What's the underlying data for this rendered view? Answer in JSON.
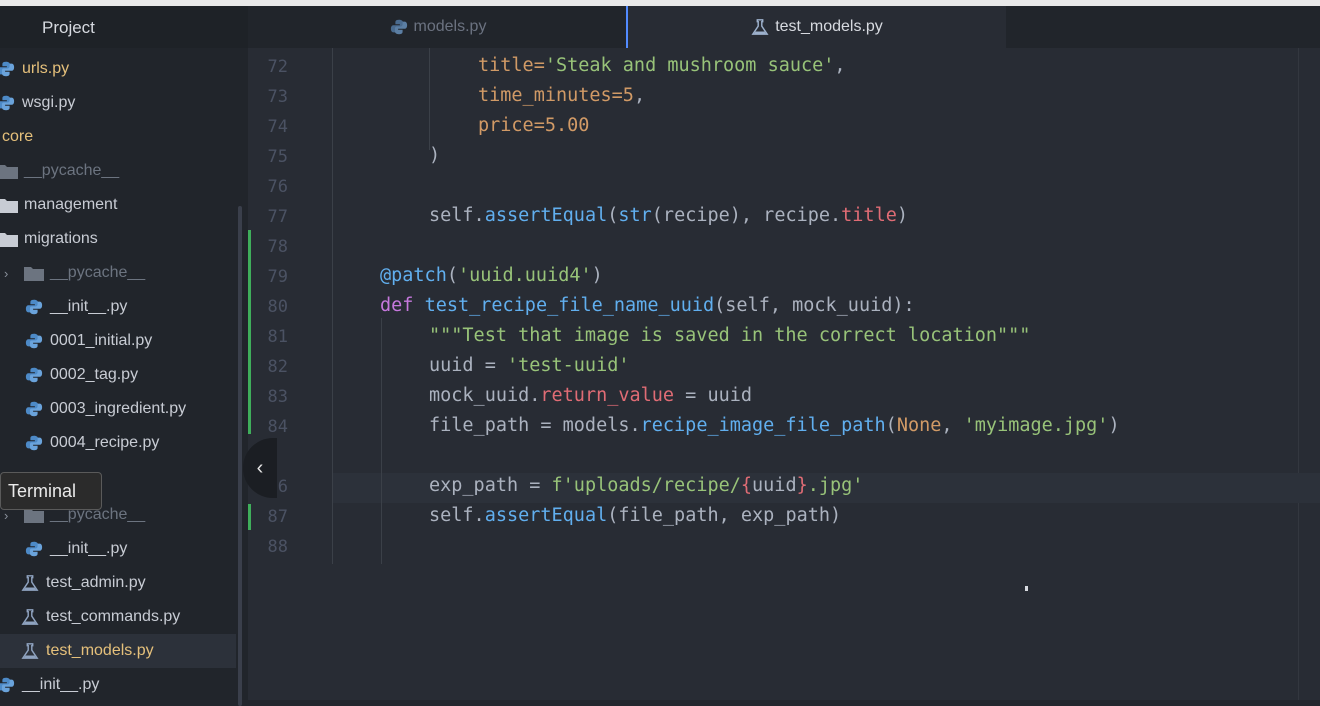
{
  "sidebar": {
    "title": "Project",
    "items": [
      {
        "label": "urls.py",
        "icon": "python-icon"
      },
      {
        "label": "wsgi.py",
        "icon": "python-icon"
      },
      {
        "label": "core",
        "icon": ""
      },
      {
        "label": "__pycache__",
        "icon": "folder-icon"
      },
      {
        "label": "management",
        "icon": "folder-icon"
      },
      {
        "label": "migrations",
        "icon": "folder-icon"
      },
      {
        "label": "__pycache__",
        "icon": "folder-icon"
      },
      {
        "label": "__init__.py",
        "icon": "python-icon"
      },
      {
        "label": "0001_initial.py",
        "icon": "python-icon"
      },
      {
        "label": "0002_tag.py",
        "icon": "python-icon"
      },
      {
        "label": "0003_ingredient.py",
        "icon": "python-icon"
      },
      {
        "label": "0004_recipe.py",
        "icon": "python-icon"
      },
      {
        "label": "__pycache__",
        "icon": "folder-icon"
      },
      {
        "label": "__init__.py",
        "icon": "python-icon"
      },
      {
        "label": "test_admin.py",
        "icon": "test-flask-icon"
      },
      {
        "label": "test_commands.py",
        "icon": "test-flask-icon"
      },
      {
        "label": "test_models.py",
        "icon": "test-flask-icon"
      },
      {
        "label": "__init__.py",
        "icon": "python-icon"
      }
    ]
  },
  "tooltip": {
    "label": "Terminal"
  },
  "tabs": [
    {
      "label": "models.py",
      "icon": "python-icon",
      "active": false
    },
    {
      "label": "test_models.py",
      "icon": "test-flask-icon",
      "active": true
    }
  ],
  "editor": {
    "line_numbers": [
      "72",
      "73",
      "74",
      "75",
      "76",
      "77",
      "78",
      "79",
      "80",
      "81",
      "82",
      "83",
      "84",
      "",
      "6",
      "87",
      "88"
    ],
    "code": {
      "l72": {
        "a": "title=",
        "b": "'Steak and mushroom sauce'",
        "c": ","
      },
      "l73": {
        "a": "time_minutes=",
        "b": "5",
        "c": ","
      },
      "l74": {
        "a": "price=",
        "b": "5.00"
      },
      "l75": {
        "a": ")"
      },
      "l77": {
        "a": "self.",
        "b": "assertEqual",
        "c": "(",
        "d": "str",
        "e": "(recipe), recipe.",
        "f": "title",
        "g": ")"
      },
      "l79": {
        "a": "@patch",
        "b": "(",
        "c": "'uuid.uuid4'",
        "d": ")"
      },
      "l80": {
        "a": "def ",
        "b": "test_recipe_file_name_uuid",
        "c": "(self, mock_uuid):"
      },
      "l81": {
        "a": "\"\"\"Test that image is saved in the correct location\"\"\""
      },
      "l82": {
        "a": "uuid = ",
        "b": "'test-uuid'"
      },
      "l83": {
        "a": "mock_uuid.",
        "b": "return_value",
        "c": " = uuid"
      },
      "l84": {
        "a": "file_path = models.",
        "b": "recipe_image_file_path",
        "c": "(",
        "d": "None",
        "e": ", ",
        "f": "'myimage.jpg'",
        "g": ")"
      },
      "l86": {
        "a": "exp_path = ",
        "b": "f'uploads/recipe/",
        "c": "{",
        "d": "uuid",
        "e": "}",
        "f": ".jpg'"
      },
      "l87": {
        "a": "self.",
        "b": "assertEqual",
        "c": "(file_path, exp_path)"
      }
    }
  },
  "colors": {
    "keyword": "#c678dd",
    "function": "#61afef",
    "string": "#98c379",
    "number": "#d19a66",
    "property": "#e06c75",
    "git_added": "#3fae5b"
  }
}
